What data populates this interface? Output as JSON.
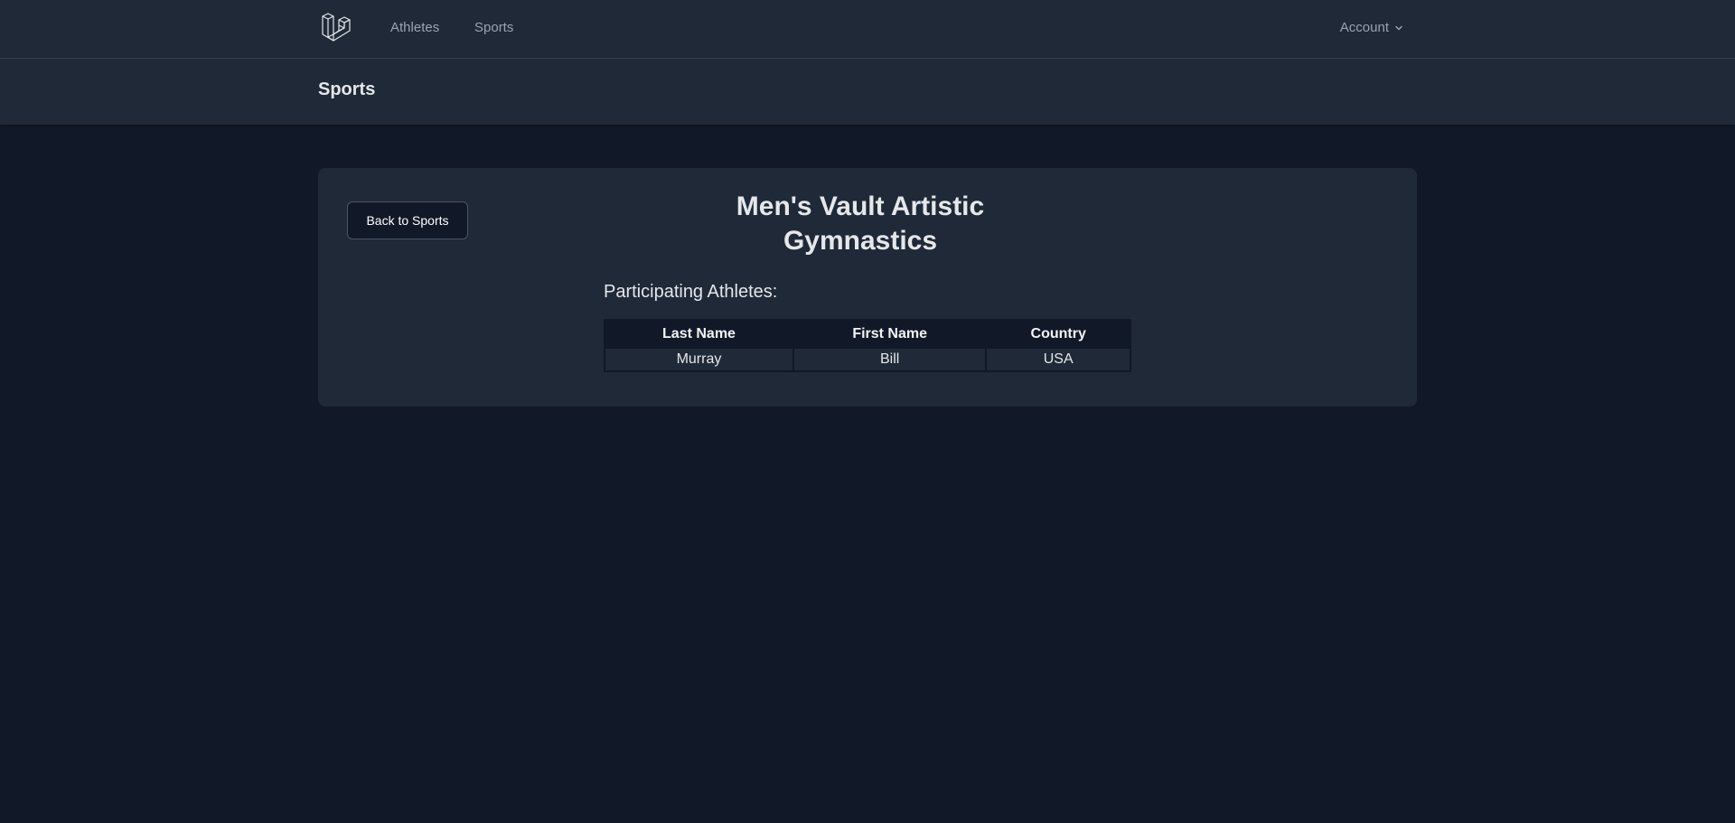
{
  "nav": {
    "links": [
      "Athletes",
      "Sports"
    ],
    "account_label": "Account",
    "logo_icon": "laravel-logo-icon",
    "account_icon": "chevron-down-icon"
  },
  "header": {
    "title": "Sports"
  },
  "main": {
    "back_button_label": "Back to Sports",
    "sport_title_line1": "Men's Vault Artistic",
    "sport_title_line2": "Gymnastics",
    "participants_heading": "Participating Athletes:",
    "table": {
      "columns": [
        "Last Name",
        "First Name",
        "Country"
      ],
      "rows": [
        [
          "Murray",
          "Bill",
          "USA"
        ]
      ]
    }
  },
  "colors": {
    "background": "#111827",
    "surface": "#1f2937",
    "text": "#e5e7eb",
    "muted_text": "#9ca3af"
  }
}
